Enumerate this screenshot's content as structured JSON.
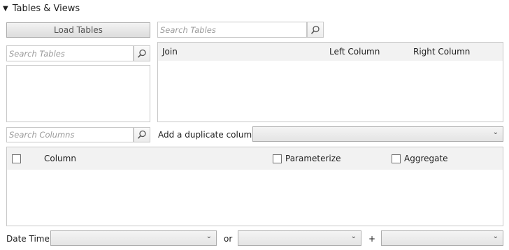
{
  "section": {
    "title": "Tables & Views",
    "icon": "collapse-triangle-icon",
    "glyph": "▼"
  },
  "toolbar": {
    "load_tables_label": "Load Tables"
  },
  "search_tables_left": {
    "placeholder": "Search Tables"
  },
  "search_tables_right": {
    "placeholder": "Search Tables"
  },
  "join_grid": {
    "headers": {
      "join": "Join",
      "left_column": "Left Column",
      "right_column": "Right Column"
    }
  },
  "search_columns": {
    "placeholder": "Search Columns"
  },
  "duplicate_column": {
    "label": "Add a duplicate column",
    "value": ""
  },
  "columns_grid": {
    "headers": {
      "column": "Column",
      "parameterize": "Parameterize",
      "aggregate": "Aggregate"
    }
  },
  "date_time": {
    "label": "Date Time",
    "or_label": "or",
    "plus_label": "+",
    "value1": "",
    "value2": "",
    "value3": ""
  },
  "glyphs": {
    "chevron": "⌄"
  },
  "colors": {
    "border": "#c8c8c8",
    "header_bg": "#f2f2f2",
    "button_gradient_top": "#f3f3f3",
    "button_gradient_bottom": "#dcdcdc"
  }
}
